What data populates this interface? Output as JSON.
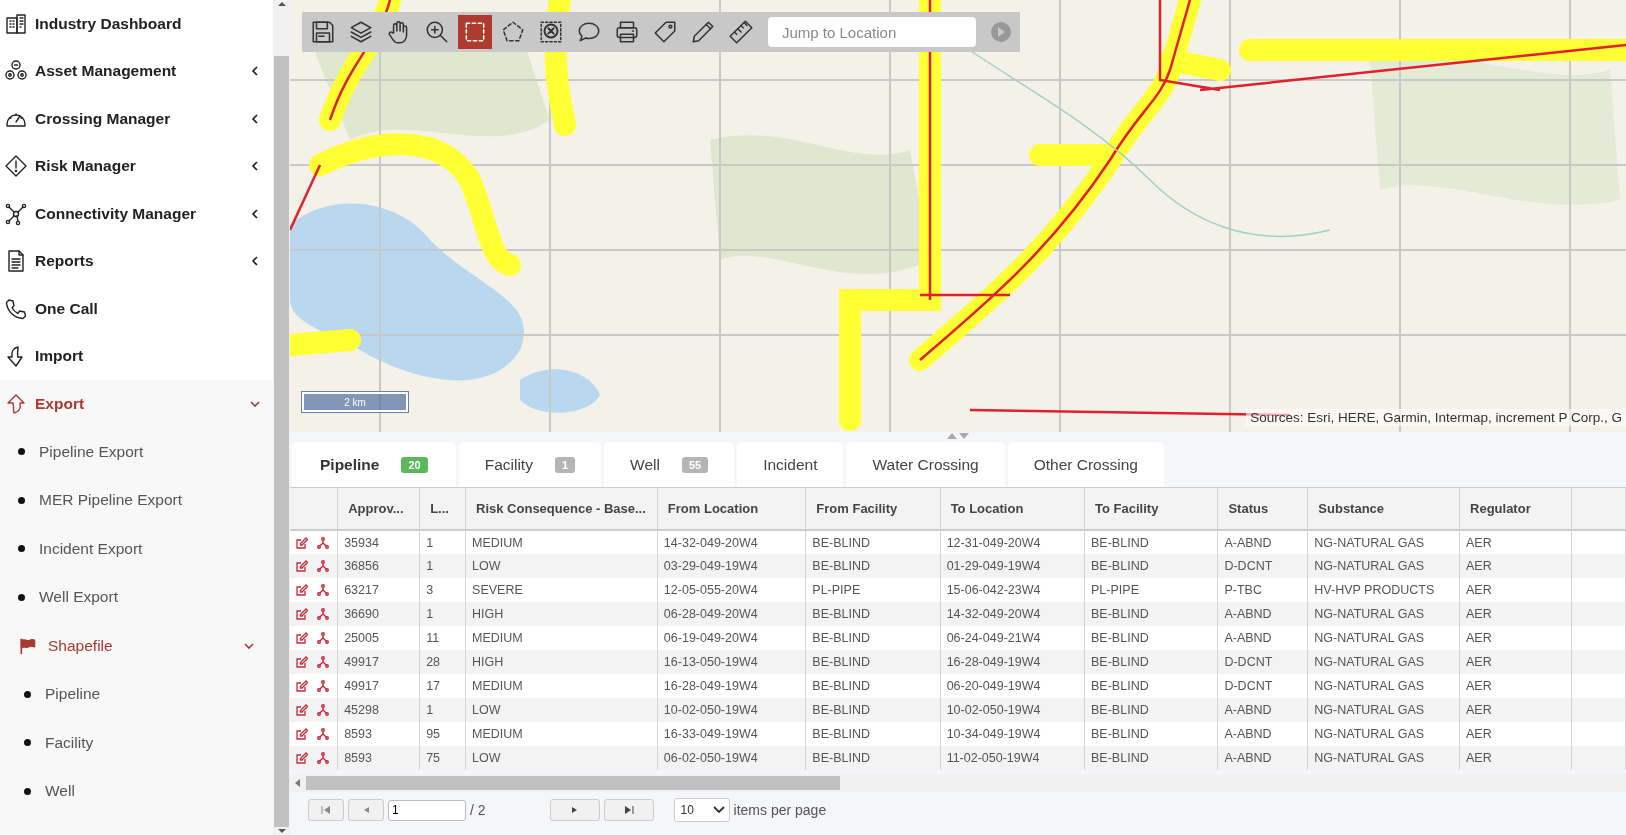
{
  "sidebar": {
    "items": [
      {
        "kind": "link",
        "label": "Industry Dashboard"
      },
      {
        "kind": "group",
        "label": "Asset Management",
        "expanded": false
      },
      {
        "kind": "group",
        "label": "Crossing Manager",
        "expanded": false
      },
      {
        "kind": "group",
        "label": "Risk Manager",
        "expanded": false
      },
      {
        "kind": "group",
        "label": "Connectivity Manager",
        "expanded": false
      },
      {
        "kind": "group",
        "label": "Reports",
        "expanded": false
      },
      {
        "kind": "link",
        "label": "One Call"
      },
      {
        "kind": "link",
        "label": "Import"
      },
      {
        "kind": "group",
        "label": "Export",
        "expanded": true,
        "children": [
          {
            "kind": "link",
            "label": "Pipeline Export"
          },
          {
            "kind": "link",
            "label": "MER Pipeline Export"
          },
          {
            "kind": "link",
            "label": "Incident Export"
          },
          {
            "kind": "link",
            "label": "Well Export"
          },
          {
            "kind": "group",
            "label": "Shapefile",
            "expanded": true,
            "children": [
              {
                "kind": "link",
                "label": "Pipeline"
              },
              {
                "kind": "link",
                "label": "Facility"
              },
              {
                "kind": "link",
                "label": "Well"
              }
            ]
          }
        ]
      }
    ]
  },
  "map": {
    "tools": [
      {
        "kind": "save",
        "selected": false
      },
      {
        "kind": "layers",
        "selected": false
      },
      {
        "kind": "pan",
        "selected": false
      },
      {
        "kind": "zoom",
        "selected": false
      },
      {
        "kind": "select-rect",
        "selected": true
      },
      {
        "kind": "select-polygon",
        "selected": false
      },
      {
        "kind": "clear-selection",
        "selected": false
      },
      {
        "kind": "comment",
        "selected": false
      },
      {
        "kind": "print",
        "selected": false
      },
      {
        "kind": "tag",
        "selected": false
      },
      {
        "kind": "pencil",
        "selected": false
      },
      {
        "kind": "ruler",
        "selected": false
      }
    ],
    "search": {
      "placeholder": "Jump to Location"
    },
    "scale": "2 km",
    "attribution": "Sources: Esri, HERE, Garmin, Intermap, increment P Corp., G"
  },
  "tabs": [
    {
      "label": "Pipeline",
      "count": "20",
      "color": "#5cb85c",
      "selected": true
    },
    {
      "label": "Facility",
      "count": "1",
      "color": "#b5b5b5",
      "selected": false
    },
    {
      "label": "Well",
      "count": "55",
      "color": "#b5b5b5",
      "selected": false
    },
    {
      "label": "Incident",
      "selected": false
    },
    {
      "label": "Water Crossing",
      "selected": false
    },
    {
      "label": "Other Crossing",
      "selected": false
    }
  ],
  "table": {
    "columns": [
      "Approv...",
      "L...",
      "Risk Consequence - Base...",
      "From Location",
      "From Facility",
      "To Location",
      "To Facility",
      "Status",
      "Substance",
      "Regulator"
    ],
    "rows": [
      [
        "35934",
        "1",
        "MEDIUM",
        "14-32-049-20W4",
        "BE-BLIND",
        "12-31-049-20W4",
        "BE-BLIND",
        "A-ABND",
        "NG-NATURAL GAS",
        "AER"
      ],
      [
        "36856",
        "1",
        "LOW",
        "03-29-049-19W4",
        "BE-BLIND",
        "01-29-049-19W4",
        "BE-BLIND",
        "D-DCNT",
        "NG-NATURAL GAS",
        "AER"
      ],
      [
        "63217",
        "3",
        "SEVERE",
        "12-05-055-20W4",
        "PL-PIPE",
        "15-06-042-23W4",
        "PL-PIPE",
        "P-TBC",
        "HV-HVP PRODUCTS",
        "AER"
      ],
      [
        "36690",
        "1",
        "HIGH",
        "06-28-049-20W4",
        "BE-BLIND",
        "14-32-049-20W4",
        "BE-BLIND",
        "A-ABND",
        "NG-NATURAL GAS",
        "AER"
      ],
      [
        "25005",
        "11",
        "MEDIUM",
        "06-19-049-20W4",
        "BE-BLIND",
        "06-24-049-21W4",
        "BE-BLIND",
        "A-ABND",
        "NG-NATURAL GAS",
        "AER"
      ],
      [
        "49917",
        "28",
        "HIGH",
        "16-13-050-19W4",
        "BE-BLIND",
        "16-28-049-19W4",
        "BE-BLIND",
        "D-DCNT",
        "NG-NATURAL GAS",
        "AER"
      ],
      [
        "49917",
        "17",
        "MEDIUM",
        "16-28-049-19W4",
        "BE-BLIND",
        "06-20-049-19W4",
        "BE-BLIND",
        "D-DCNT",
        "NG-NATURAL GAS",
        "AER"
      ],
      [
        "45298",
        "1",
        "LOW",
        "10-02-050-19W4",
        "BE-BLIND",
        "10-02-050-19W4",
        "BE-BLIND",
        "A-ABND",
        "NG-NATURAL GAS",
        "AER"
      ],
      [
        "8593",
        "95",
        "MEDIUM",
        "16-33-049-19W4",
        "BE-BLIND",
        "10-34-049-19W4",
        "BE-BLIND",
        "A-ABND",
        "NG-NATURAL GAS",
        "AER"
      ],
      [
        "8593",
        "75",
        "LOW",
        "06-02-050-19W4",
        "BE-BLIND",
        "11-02-050-19W4",
        "BE-BLIND",
        "A-ABND",
        "NG-NATURAL GAS",
        "AER"
      ]
    ]
  },
  "pager": {
    "page": "1",
    "total": "/ 2",
    "page_size": "10",
    "page_size_label": "items per page"
  }
}
